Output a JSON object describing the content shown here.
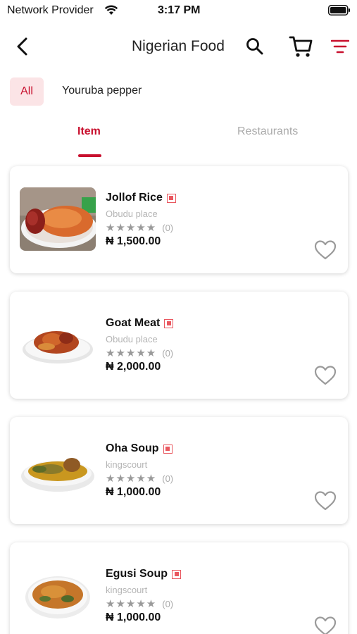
{
  "status_bar": {
    "carrier": "Network Provider",
    "time": "3:17 PM"
  },
  "header": {
    "title": "Nigerian Food"
  },
  "filters": {
    "chips": [
      "All",
      "Youruba pepper"
    ],
    "active": "All"
  },
  "tabs": {
    "items": [
      "Item",
      "Restaurants"
    ],
    "active": "Item"
  },
  "colors": {
    "accent": "#c8102e",
    "chip_bg": "#fbe4e6"
  },
  "items": [
    {
      "name": "Jollof Rice",
      "restaurant": "Obudu place",
      "rating_count": "(0)",
      "price": "₦ 1,500.00",
      "stars": "★★★★★"
    },
    {
      "name": "Goat Meat",
      "restaurant": "Obudu place",
      "rating_count": "(0)",
      "price": "₦ 2,000.00",
      "stars": "★★★★★"
    },
    {
      "name": "Oha Soup",
      "restaurant": "kingscourt",
      "rating_count": "(0)",
      "price": "₦ 1,000.00",
      "stars": "★★★★★"
    },
    {
      "name": "Egusi Soup",
      "restaurant": "kingscourt",
      "rating_count": "(0)",
      "price": "₦ 1,000.00",
      "stars": "★★★★★"
    }
  ]
}
